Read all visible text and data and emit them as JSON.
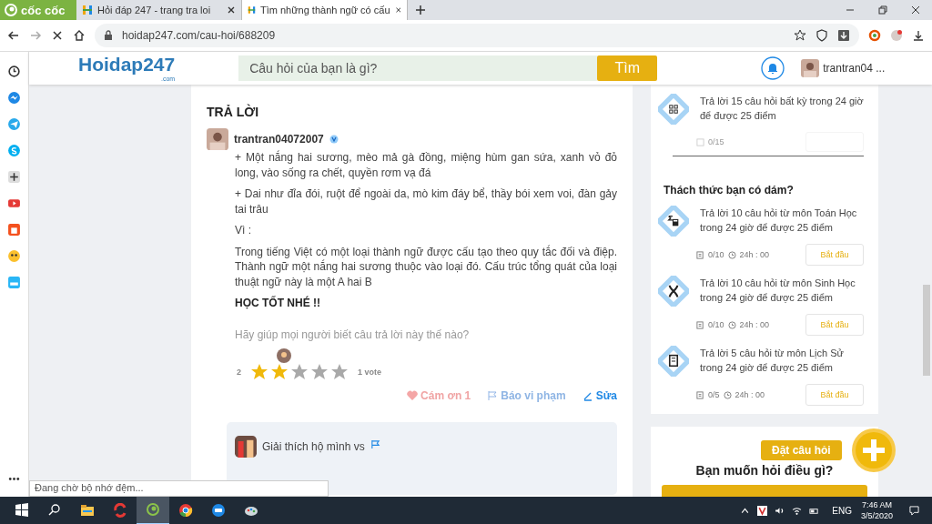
{
  "browser": {
    "brand": "cốc cốc",
    "tabs": [
      {
        "title": "Hỏi đáp 247 - trang tra loi",
        "selected": false
      },
      {
        "title": "Tìm những thành ngữ có cấu",
        "selected": true
      }
    ],
    "address": "hoidap247.com/cau-hoi/688209"
  },
  "site_header": {
    "logo": "Hoidap247",
    "logo_sub": ".com",
    "search_placeholder": "Câu hỏi của bạn là gì?",
    "search_button": "Tìm",
    "user": "trantran04 ..."
  },
  "answer": {
    "heading": "TRẢ LỜI",
    "author": "trantran04072007",
    "paragraphs": [
      "+ Một nắng hai sương, mèo mả gà đồng, miệng hùm gan sứa, xanh vỏ đỏ long, vào sống ra chết, quyền rơm vạ đá",
      "+ Dai như đỉa đói, ruột để ngoài da, mò kim đáy bể, thầy bói xem voi, đàn gảy tai trâu",
      "Vì :",
      "Trong tiếng Việt có một loại thành ngữ được cấu tạo theo quy tắc đối và điệp. Thành ngữ một nắng hai sương thuộc vào loại đó. Cấu trúc tổng quát của loại thuật ngữ này là một A hai B"
    ],
    "closing": "HỌC TỐT NHÉ !!",
    "rating_prompt": "Hãy giúp mọi người biết câu trả lời này thế nào?",
    "rating_value": "2",
    "stars": 2,
    "votes": "1 vote",
    "actions": [
      {
        "kind": "thanks",
        "label": "Cám ơn 1"
      },
      {
        "kind": "report",
        "label": "Báo vi phạm"
      },
      {
        "kind": "edit",
        "label": "Sửa"
      }
    ],
    "comment": "Giải thích hộ mình vs"
  },
  "daily": {
    "text": "Trả lời 15 câu hỏi  bất kỳ  trong 24 giờ để được 25 điểm",
    "progress": "0/15"
  },
  "challenges": {
    "heading": "Thách thức bạn có dám?",
    "items": [
      {
        "kind": "math",
        "text": "Trả lời 10 câu hỏi  từ môn Toán Học  trong 24 giờ để được 25 điểm",
        "progress": "0/10",
        "time": "24h : 00",
        "button": "Bắt đầu"
      },
      {
        "kind": "biology",
        "text": "Trả lời 10 câu hỏi  từ môn Sinh Học  trong 24 giờ để được 25 điểm",
        "progress": "0/10",
        "time": "24h : 00",
        "button": "Bắt đầu"
      },
      {
        "kind": "history",
        "text": "Trả lời 5 câu hỏi  từ môn Lịch Sử  trong 24 giờ để được 25 điểm",
        "progress": "0/5",
        "time": "24h : 00",
        "button": "Bắt đầu"
      }
    ]
  },
  "ask": {
    "fab_label": "Đặt câu hỏi",
    "heading": "Bạn muốn hỏi điều gì?"
  },
  "status_popup": "Đang chờ bộ nhớ đệm...",
  "taskbar": {
    "language": "ENG",
    "time": "7:46 AM",
    "date": "3/5/2020"
  }
}
